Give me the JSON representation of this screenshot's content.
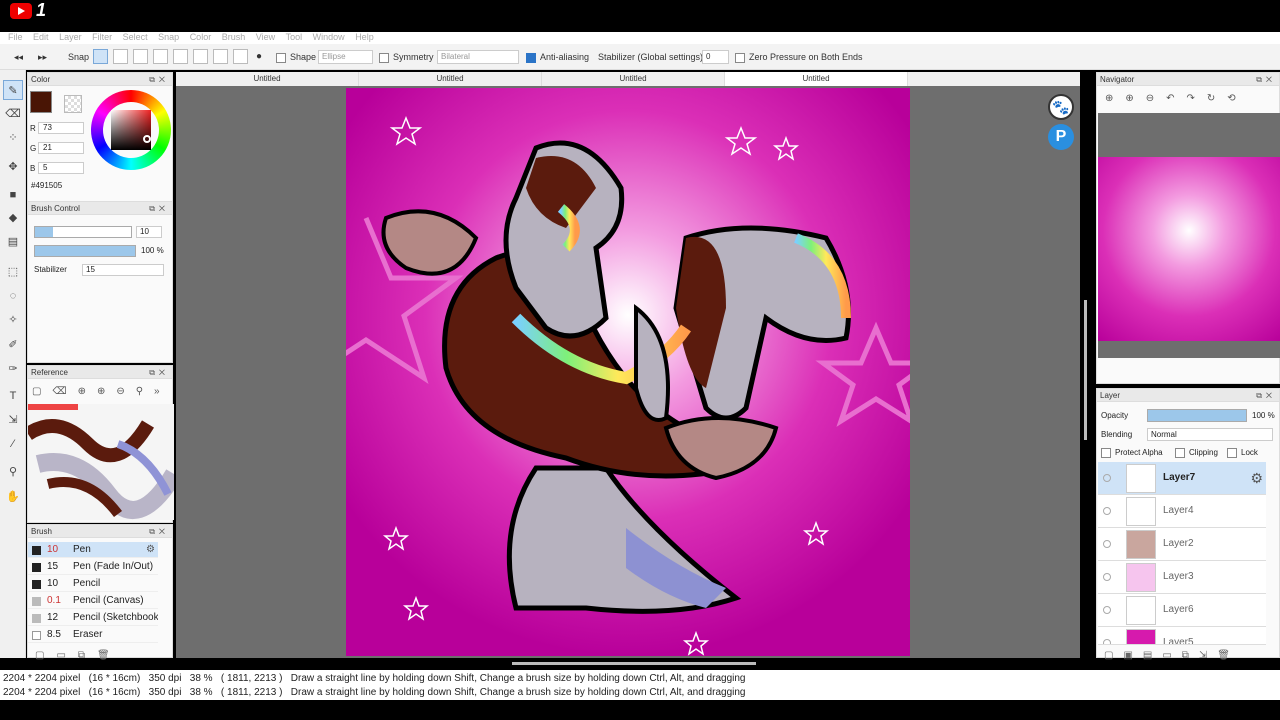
{
  "video_overlay": {
    "channel_number": "1"
  },
  "menu": [
    "File",
    "Edit",
    "Layer",
    "Filter",
    "Select",
    "Snap",
    "Color",
    "Brush",
    "View",
    "Tool",
    "Window",
    "Help"
  ],
  "toolbar": {
    "snap_label": "Snap",
    "shape_label": "Shape",
    "shape_value": "Ellipse",
    "symmetry_label": "Symmetry",
    "symmetry_value": "Bilateral",
    "antialiasing_label": "Anti-aliasing",
    "stabilizer_label": "Stabilizer (Global settings)",
    "stabilizer_value": "0",
    "zero_pressure_label": "Zero Pressure on Both Ends"
  },
  "color_panel": {
    "title": "Color",
    "r_label": "R",
    "r_value": "73",
    "g_label": "G",
    "g_value": "21",
    "b_label": "B",
    "b_value": "5",
    "hex": "#491505",
    "main_color": "#491505",
    "secondary_color": "#c8187c"
  },
  "brush_control": {
    "title": "Brush Control",
    "size_value": "10",
    "opacity_value": "100 %",
    "stabilizer_label": "Stabilizer",
    "stabilizer_value": "15"
  },
  "reference": {
    "title": "Reference"
  },
  "brush_panel": {
    "title": "Brush",
    "items": [
      {
        "size": "10",
        "name": "Pen"
      },
      {
        "size": "15",
        "name": "Pen (Fade In/Out)"
      },
      {
        "size": "10",
        "name": "Pencil"
      },
      {
        "size": "0.1",
        "name": "Pencil (Canvas)"
      },
      {
        "size": "12",
        "name": "Pencil (Sketchbook)"
      },
      {
        "size": "8.5",
        "name": "Eraser"
      }
    ]
  },
  "tabs": [
    "Untitled",
    "Untitled",
    "Untitled",
    "Untitled"
  ],
  "navigator": {
    "title": "Navigator"
  },
  "layer_panel": {
    "title": "Layer",
    "opacity_label": "Opacity",
    "opacity_value": "100 %",
    "blending_label": "Blending",
    "blending_value": "Normal",
    "protect_alpha": "Protect Alpha",
    "clipping": "Clipping",
    "lock": "Lock",
    "layers": [
      "Layer7",
      "Layer4",
      "Layer2",
      "Layer3",
      "Layer6",
      "Layer5"
    ]
  },
  "status": {
    "line1": "2204 * 2204 pixel   (16 * 16cm)   350 dpi   38 %   ( 1811, 2213 )   Draw a straight line by holding down Shift, Change a brush size by holding down Ctrl, Alt, and dragging",
    "line2": "2204 * 2204 pixel   (16 * 16cm)   350 dpi   38 %   ( 1811, 2213 )   Draw a straight line by holding down Shift, Change a brush size by holding down Ctrl, Alt, and dragging"
  }
}
